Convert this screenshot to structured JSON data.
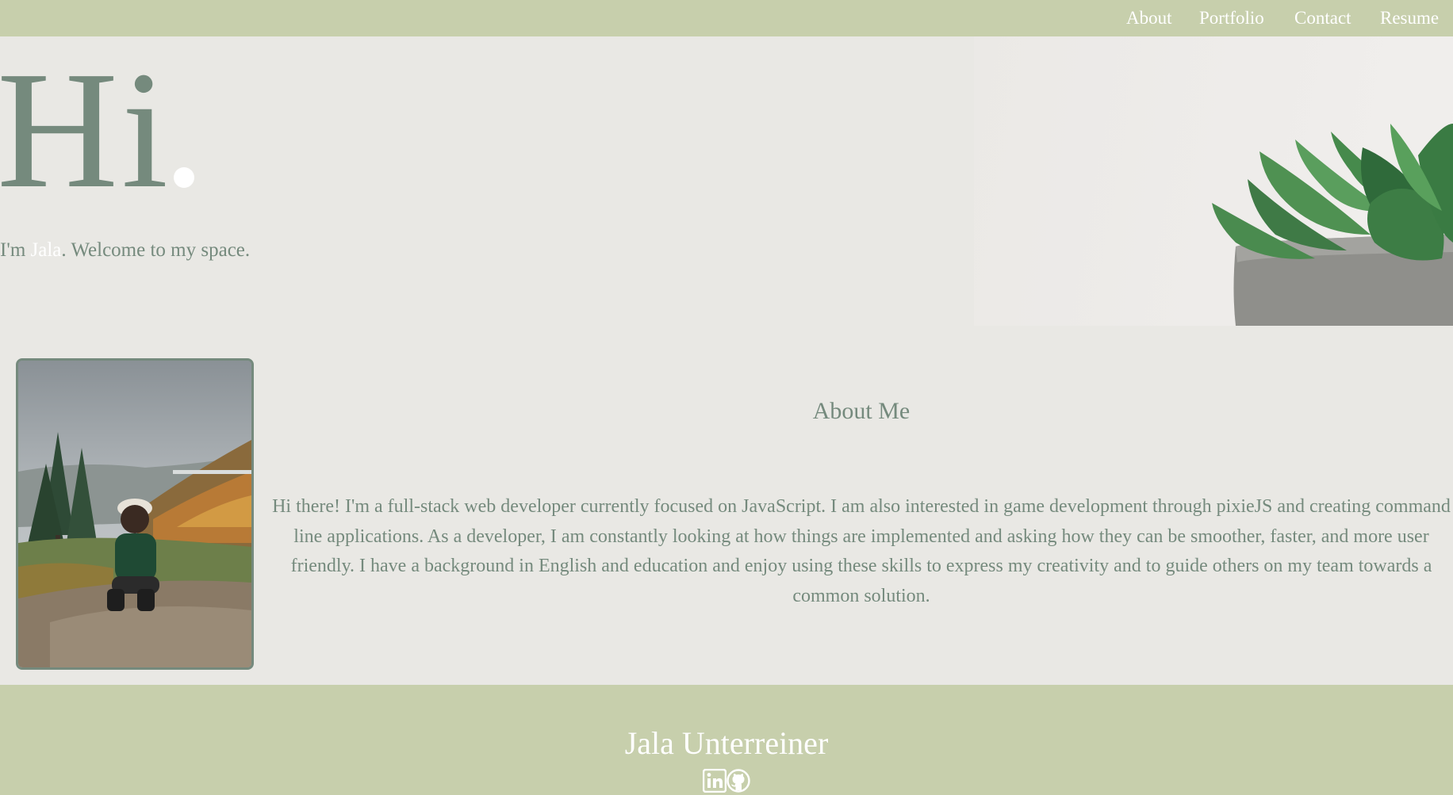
{
  "nav": {
    "items": [
      {
        "label": "About"
      },
      {
        "label": "Portfolio"
      },
      {
        "label": "Contact"
      },
      {
        "label": "Resume"
      }
    ]
  },
  "hero": {
    "heading": "Hi",
    "intro_prefix": "I'm ",
    "intro_name": "Jala",
    "intro_suffix": ". Welcome to my space."
  },
  "about": {
    "title": "About Me",
    "body": "Hi there! I'm a full-stack web developer currently focused on JavaScript. I am also interested in game development through pixieJS and creating command line applications. As a developer, I am constantly looking at how things are implemented and asking how they can be smoother, faster, and more user friendly. I have a background in English and education and enjoy using these skills to express my creativity and to guide others on my team towards a common solution."
  },
  "footer": {
    "name": "Jala Unterreiner",
    "icons": [
      "linkedin-icon",
      "github-icon"
    ]
  },
  "colors": {
    "accent_green": "#c7cfac",
    "text_sage": "#758a7d",
    "background": "#e9e8e4",
    "white": "#ffffff"
  }
}
